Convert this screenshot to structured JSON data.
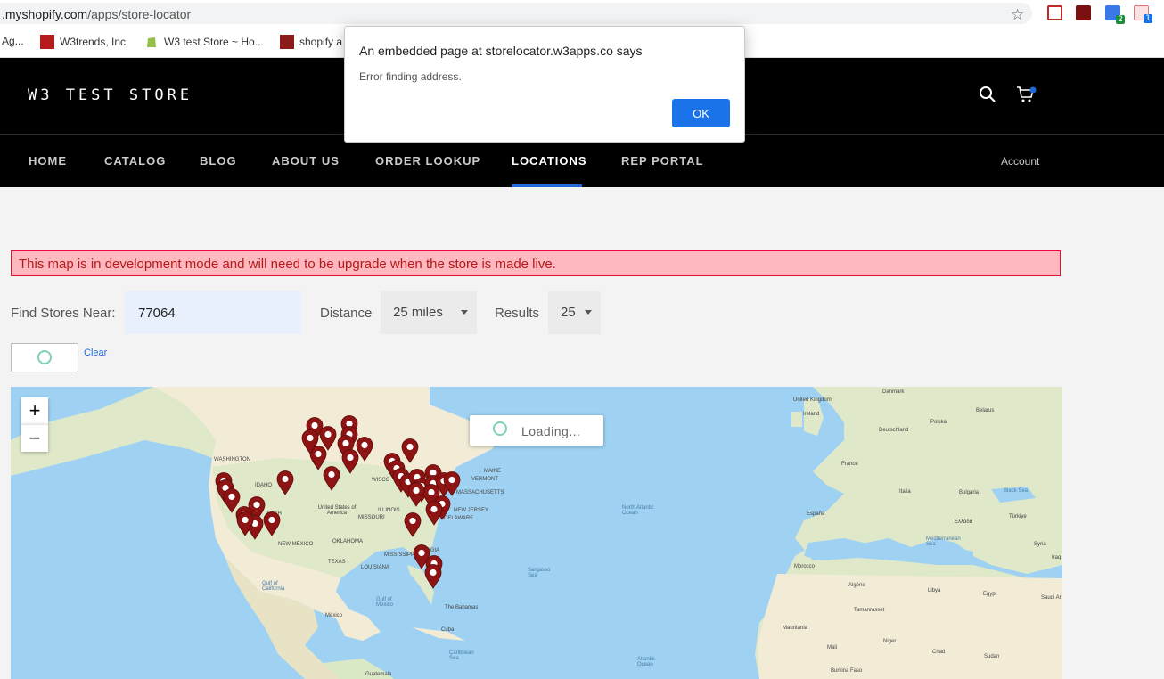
{
  "browser": {
    "url_host": ".myshopify.com",
    "url_path": "/apps/store-locator",
    "bookmarks": [
      {
        "label": "Ag..."
      },
      {
        "label": "W3trends, Inc."
      },
      {
        "label": "W3 test Store ~ Ho..."
      },
      {
        "label": "shopify a"
      }
    ],
    "extensions": [
      {
        "icon": "shield-extension-icon",
        "color": "#c62828"
      },
      {
        "icon": "pdf-extension-icon",
        "color": "#7a1010"
      },
      {
        "icon": "code-extension-icon",
        "color": "#3b78e7",
        "badge": "2",
        "badge_color": "#1e8e3e"
      },
      {
        "icon": "puzzle-extension-icon",
        "color": "#e57373",
        "badge": "1",
        "badge_color": "#1a73e8"
      }
    ]
  },
  "dialog": {
    "title": "An embedded page at storelocator.w3apps.co says",
    "message": "Error finding address.",
    "ok_label": "OK"
  },
  "store": {
    "logo": "W3 TEST STORE",
    "nav": [
      {
        "label": "HOME"
      },
      {
        "label": "CATALOG"
      },
      {
        "label": "BLOG"
      },
      {
        "label": "ABOUT US"
      },
      {
        "label": "ORDER LOOKUP"
      },
      {
        "label": "LOCATIONS",
        "active": true
      },
      {
        "label": "REP PORTAL"
      }
    ],
    "account_label": "Account",
    "accent_color": "#1e6ad9"
  },
  "locator": {
    "dev_banner": "This map is in development mode and will need to be upgrade when the store is made live.",
    "find_label": "Find Stores Near:",
    "zip_value": "77064",
    "distance_label": "Distance",
    "distance_value": "25 miles",
    "results_label": "Results",
    "results_value": "25",
    "clear_label": "Clear"
  },
  "map": {
    "zoom_in": "+",
    "zoom_out": "−",
    "loading_text": "Loading...",
    "labels": {
      "washington": "WASHINGTON",
      "idaho": "IDAHO",
      "utah": "UTAH",
      "new_mexico": "NEW MEXICO",
      "texas": "TEXAS",
      "oklahoma": "OKLAHOMA",
      "missouri": "MISSOURI",
      "illinois": "ILLINOIS",
      "wisconsin": "WISCO",
      "mississippi": "MISSISSIPPI",
      "louisiana": "LOUISIANA",
      "georgia": "GEORGIA",
      "maine": "MAINE",
      "vermont": "VERMONT",
      "massachusetts": "MASSACHUSETTS",
      "new_jersey": "NEW JERSEY",
      "delaware": "DELAWARE",
      "usa": "United States of America",
      "mexico": "México",
      "gulf_california": "Gulf of California",
      "gulf_mexico": "Gulf of Mexico",
      "caribbean": "Caribbean Sea",
      "north_atlantic": "North Atlantic Ocean",
      "sargasso": "Sargasso Sea",
      "atlantic": "Atlantic Ocean",
      "uk": "United Kingdom",
      "ireland": "Ireland",
      "france": "France",
      "spain": "España",
      "italy": "Italia",
      "germany": "Deutschland",
      "poland": "Polska",
      "morocco": "Morocco",
      "algeria": "Algérie",
      "libya": "Libya",
      "egypt": "Egypt",
      "mali": "Mali",
      "niger": "Niger",
      "chad": "Chad",
      "mauritania": "Mauritania",
      "turkey": "Türkiye",
      "greece": "Ελλάδα",
      "black_sea": "Black Sea",
      "mediterranean": "Mediterranean Sea",
      "saudi": "Saudi Ar",
      "sudan": "Sudan",
      "burkina": "Burkina Faso",
      "tamanrasset": "Tamanrasset",
      "denmark": "Danmark",
      "belarus": "Belarus",
      "bulgaria": "Bulgaria",
      "syria": "Syria",
      "iraq": "Iraq",
      "cuba": "Cuba",
      "bahamas": "The Bahamas",
      "guatemala": "Guatemala"
    }
  }
}
